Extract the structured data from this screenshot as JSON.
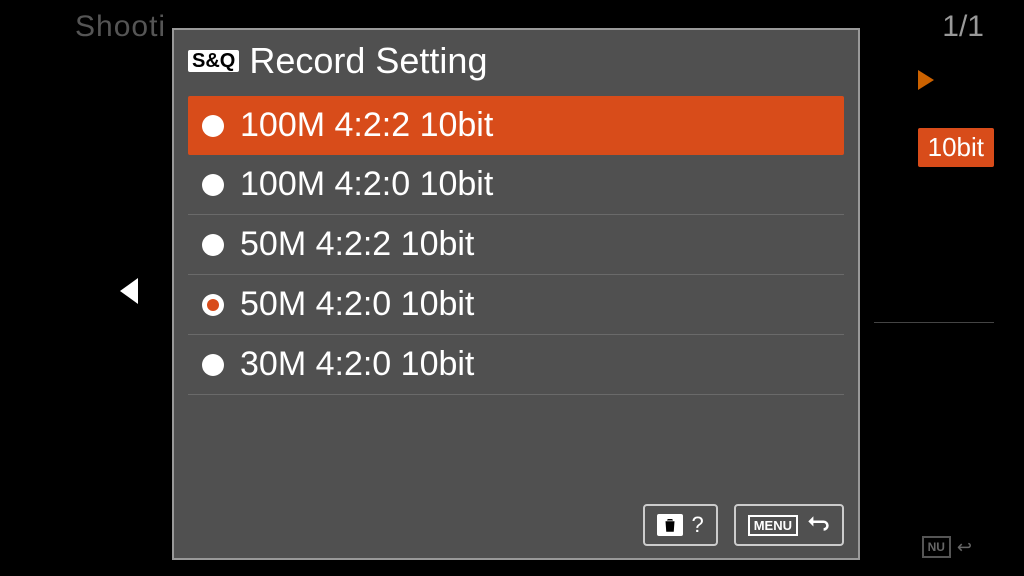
{
  "background": {
    "top_left_text": "Shooti",
    "page_indicator": "1/1",
    "badge_text": "10bit",
    "menu_text": "NU"
  },
  "modal": {
    "badge": "S&Q",
    "title": "Record Setting",
    "options": [
      {
        "label": "100M 4:2:2 10bit"
      },
      {
        "label": "100M 4:2:0 10bit"
      },
      {
        "label": "50M 4:2:2 10bit"
      },
      {
        "label": "50M 4:2:0 10bit"
      },
      {
        "label": "30M 4:2:0 10bit"
      }
    ],
    "highlighted_index": 0,
    "selected_index": 3,
    "footer": {
      "help_text": "?",
      "menu_text": "MENU"
    }
  }
}
